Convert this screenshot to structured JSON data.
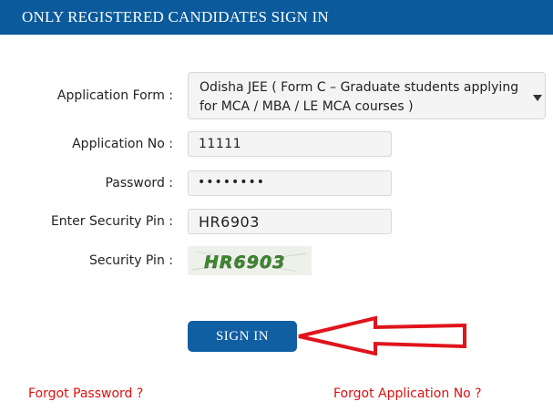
{
  "header": {
    "title": "ONLY REGISTERED CANDIDATES SIGN IN",
    "background_color": "#0a5a9c"
  },
  "form": {
    "application_form": {
      "label": "Application Form :",
      "selected_value": "Odisha JEE ( Form C – Graduate students applying for MCA / MBA / LE MCA courses )"
    },
    "application_no": {
      "label": "Application No :",
      "value": "11111"
    },
    "password": {
      "label": "Password :",
      "masked_value": "••••••••"
    },
    "enter_security_pin": {
      "label": "Enter Security Pin :",
      "value": "HR6903"
    },
    "security_pin": {
      "label": "Security Pin :",
      "captcha_text": "HR6903"
    }
  },
  "actions": {
    "sign_in_label": "SIGN IN",
    "button_color": "#115fa3",
    "pointer_arrow_color": "#e0141c"
  },
  "links": {
    "forgot_password": "Forgot Password ?",
    "forgot_application_no": "Forgot Application No ?",
    "link_color": "#e01010"
  }
}
